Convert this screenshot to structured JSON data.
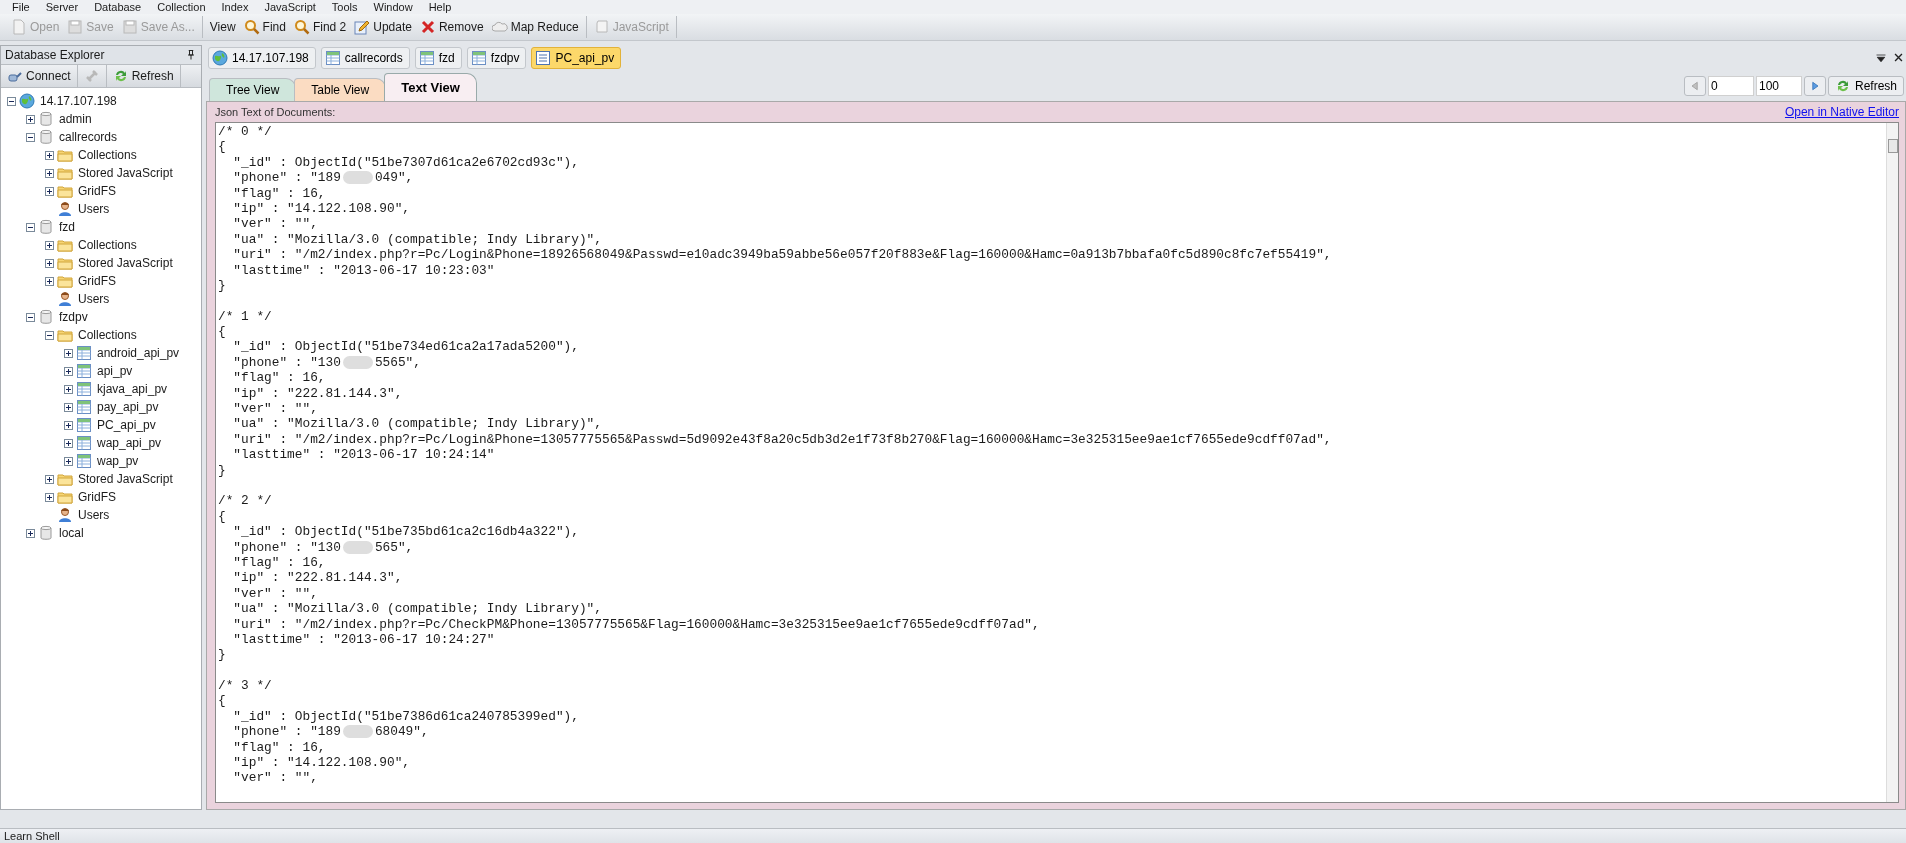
{
  "menu": [
    "File",
    "Server",
    "Database",
    "Collection",
    "Index",
    "JavaScript",
    "Tools",
    "Window",
    "Help"
  ],
  "toolbar": [
    [
      {
        "label": "Open",
        "kind": "open",
        "disabled": true
      },
      {
        "label": "Save",
        "kind": "save",
        "disabled": true
      },
      {
        "label": "Save As...",
        "kind": "save",
        "disabled": true
      }
    ],
    [
      {
        "label": "View",
        "kind": "plain",
        "disabled": false
      },
      {
        "label": "Find",
        "kind": "find",
        "disabled": false
      },
      {
        "label": "Find 2",
        "kind": "find",
        "disabled": false
      },
      {
        "label": "Update",
        "kind": "update",
        "disabled": false
      },
      {
        "label": "Remove",
        "kind": "remove",
        "disabled": false
      },
      {
        "label": "Map Reduce",
        "kind": "cloud",
        "disabled": false
      }
    ],
    [
      {
        "label": "JavaScript",
        "kind": "script",
        "disabled": true
      }
    ]
  ],
  "explorer": {
    "title": "Database Explorer",
    "actions": [
      {
        "label": "Connect",
        "kind": "connect",
        "disabled": false
      },
      {
        "kind": "disconnect",
        "disabled": true
      },
      {
        "label": "Refresh",
        "kind": "refresh",
        "disabled": false
      }
    ],
    "tree": [
      {
        "label": "14.17.107.198",
        "kind": "server",
        "expanded": true,
        "children": [
          {
            "label": "admin",
            "kind": "database",
            "expanded": false
          },
          {
            "label": "callrecords",
            "kind": "database",
            "expanded": true,
            "children": [
              {
                "label": "Collections",
                "kind": "folder",
                "expanded": false
              },
              {
                "label": "Stored JavaScript",
                "kind": "folder",
                "expanded": false
              },
              {
                "label": "GridFS",
                "kind": "folder",
                "expanded": false
              },
              {
                "label": "Users",
                "kind": "users"
              }
            ]
          },
          {
            "label": "fzd",
            "kind": "database",
            "expanded": true,
            "children": [
              {
                "label": "Collections",
                "kind": "folder",
                "expanded": false
              },
              {
                "label": "Stored JavaScript",
                "kind": "folder",
                "expanded": false
              },
              {
                "label": "GridFS",
                "kind": "folder",
                "expanded": false
              },
              {
                "label": "Users",
                "kind": "users"
              }
            ]
          },
          {
            "label": "fzdpv",
            "kind": "database",
            "expanded": true,
            "children": [
              {
                "label": "Collections",
                "kind": "folder",
                "expanded": true,
                "children": [
                  {
                    "label": "android_api_pv",
                    "kind": "table",
                    "expanded": false
                  },
                  {
                    "label": "api_pv",
                    "kind": "table",
                    "expanded": false
                  },
                  {
                    "label": "kjava_api_pv",
                    "kind": "table",
                    "expanded": false
                  },
                  {
                    "label": "pay_api_pv",
                    "kind": "table",
                    "expanded": false
                  },
                  {
                    "label": "PC_api_pv",
                    "kind": "table",
                    "expanded": false
                  },
                  {
                    "label": "wap_api_pv",
                    "kind": "table",
                    "expanded": false
                  },
                  {
                    "label": "wap_pv",
                    "kind": "table",
                    "expanded": false
                  }
                ]
              },
              {
                "label": "Stored JavaScript",
                "kind": "folder",
                "expanded": false
              },
              {
                "label": "GridFS",
                "kind": "folder",
                "expanded": false
              },
              {
                "label": "Users",
                "kind": "users"
              }
            ]
          },
          {
            "label": "local",
            "kind": "database",
            "expanded": false
          }
        ]
      }
    ]
  },
  "doc_tabs": [
    {
      "label": "14.17.107.198",
      "kind": "server",
      "selected": false
    },
    {
      "label": "callrecords",
      "kind": "table",
      "selected": false
    },
    {
      "label": "fzd",
      "kind": "table",
      "selected": false
    },
    {
      "label": "fzdpv",
      "kind": "table",
      "selected": false
    },
    {
      "label": "PC_api_pv",
      "kind": "list",
      "selected": true
    }
  ],
  "view_tabs": [
    {
      "label": "Tree View",
      "color": "#cfe6dc",
      "selected": false
    },
    {
      "label": "Table View",
      "color": "#fbdcc2",
      "selected": false
    },
    {
      "label": "Text View",
      "color": "#f8eef2",
      "selected": true
    }
  ],
  "pager": {
    "skip": "0",
    "limit": "100",
    "refresh": "Refresh"
  },
  "panel": {
    "label": "Json Text of Documents:",
    "link": "Open in Native Editor",
    "documents": [
      [
        {
          "kind": "code",
          "text": "/* 0 */"
        },
        {
          "kind": "code",
          "text": "{"
        },
        {
          "kind": "code",
          "text": "  \"_id\" : ObjectId(\"51be7307d61ca2e6702cd93c\"),"
        },
        {
          "kind": "redacted",
          "before": "  \"phone\" : \"189",
          "after": "049\","
        },
        {
          "kind": "code",
          "text": "  \"flag\" : 16,"
        },
        {
          "kind": "code",
          "text": "  \"ip\" : \"14.122.108.90\","
        },
        {
          "kind": "code",
          "text": "  \"ver\" : \"\","
        },
        {
          "kind": "code",
          "text": "  \"ua\" : \"Mozilla/3.0 (compatible; Indy Library)\","
        },
        {
          "kind": "code",
          "text": "  \"uri\" : \"/m2/index.php?r=Pc/Login&Phone=18926568049&Passwd=e10adc3949ba59abbe56e057f20f883e&Flag=160000&Hamc=0a913b7bbafa0fc5d890c8fc7ef55419\","
        },
        {
          "kind": "code",
          "text": "  \"lasttime\" : \"2013-06-17 10:23:03\""
        },
        {
          "kind": "code",
          "text": "}"
        }
      ],
      [
        {
          "kind": "code",
          "text": "/* 1 */"
        },
        {
          "kind": "code",
          "text": "{"
        },
        {
          "kind": "code",
          "text": "  \"_id\" : ObjectId(\"51be734ed61ca2a17ada5200\"),"
        },
        {
          "kind": "redacted",
          "before": "  \"phone\" : \"130",
          "after": "5565\","
        },
        {
          "kind": "code",
          "text": "  \"flag\" : 16,"
        },
        {
          "kind": "code",
          "text": "  \"ip\" : \"222.81.144.3\","
        },
        {
          "kind": "code",
          "text": "  \"ver\" : \"\","
        },
        {
          "kind": "code",
          "text": "  \"ua\" : \"Mozilla/3.0 (compatible; Indy Library)\","
        },
        {
          "kind": "code",
          "text": "  \"uri\" : \"/m2/index.php?r=Pc/Login&Phone=13057775565&Passwd=5d9092e43f8a20c5db3d2e1f73f8b270&Flag=160000&Hamc=3e325315ee9ae1cf7655ede9cdff07ad\","
        },
        {
          "kind": "code",
          "text": "  \"lasttime\" : \"2013-06-17 10:24:14\""
        },
        {
          "kind": "code",
          "text": "}"
        }
      ],
      [
        {
          "kind": "code",
          "text": "/* 2 */"
        },
        {
          "kind": "code",
          "text": "{"
        },
        {
          "kind": "code",
          "text": "  \"_id\" : ObjectId(\"51be735bd61ca2c16db4a322\"),"
        },
        {
          "kind": "redacted",
          "before": "  \"phone\" : \"130",
          "after": "565\","
        },
        {
          "kind": "code",
          "text": "  \"flag\" : 16,"
        },
        {
          "kind": "code",
          "text": "  \"ip\" : \"222.81.144.3\","
        },
        {
          "kind": "code",
          "text": "  \"ver\" : \"\","
        },
        {
          "kind": "code",
          "text": "  \"ua\" : \"Mozilla/3.0 (compatible; Indy Library)\","
        },
        {
          "kind": "code",
          "text": "  \"uri\" : \"/m2/index.php?r=Pc/CheckPM&Phone=13057775565&Flag=160000&Hamc=3e325315ee9ae1cf7655ede9cdff07ad\","
        },
        {
          "kind": "code",
          "text": "  \"lasttime\" : \"2013-06-17 10:24:27\""
        },
        {
          "kind": "code",
          "text": "}"
        }
      ],
      [
        {
          "kind": "code",
          "text": "/* 3 */"
        },
        {
          "kind": "code",
          "text": "{"
        },
        {
          "kind": "code",
          "text": "  \"_id\" : ObjectId(\"51be7386d61ca240785399ed\"),"
        },
        {
          "kind": "redacted",
          "before": "  \"phone\" : \"189",
          "after": "68049\","
        },
        {
          "kind": "code",
          "text": "  \"flag\" : 16,"
        },
        {
          "kind": "code",
          "text": "  \"ip\" : \"14.122.108.90\","
        },
        {
          "kind": "code",
          "text": "  \"ver\" : \"\","
        }
      ]
    ]
  },
  "status_bar": {
    "text": "Learn Shell"
  }
}
